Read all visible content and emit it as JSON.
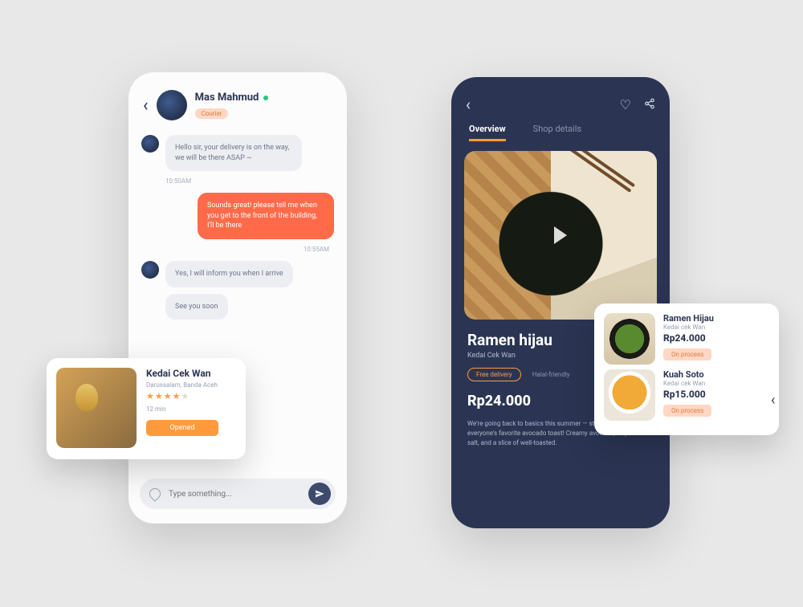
{
  "chat": {
    "contact_name": "Mas Mahmud",
    "role": "Courier",
    "messages": {
      "m1": "Hello sir, your delivery is on the way, we will be there ASAP ~",
      "t1": "10:50AM",
      "m2": "Sounds great! please tell me when you get to the front of the building, I'll be there",
      "t2": "10:55AM",
      "m3": "Yes, I will inform you when I arrive",
      "m4": "See you soon"
    },
    "composer_placeholder": "Type something..."
  },
  "shop": {
    "name": "Kedai Cek Wan",
    "address": "Darussalam, Banda Aceh",
    "eta": "12 min",
    "status": "Opened"
  },
  "product": {
    "tabs": {
      "overview": "Overview",
      "details": "Shop details"
    },
    "dish": "Ramen hijau",
    "vendor": "Kedai Cek Wan",
    "badge": "Free delivery",
    "halal": "Halal-friendly",
    "price": "Rp24.000",
    "desc": "We're going back to basics this summer — starting with everyone's favorite avocado toast! Creamy avocado, a sprinkle of salt, and a slice of well-toasted."
  },
  "orders": {
    "i1": {
      "name": "Ramen Hijau",
      "shop": "Kedai cek Wan",
      "price": "Rp24.000",
      "status": "On process"
    },
    "i2": {
      "name": "Kuah Soto",
      "shop": "Kedai cek Wan",
      "price": "Rp15.000",
      "status": "On process"
    }
  }
}
